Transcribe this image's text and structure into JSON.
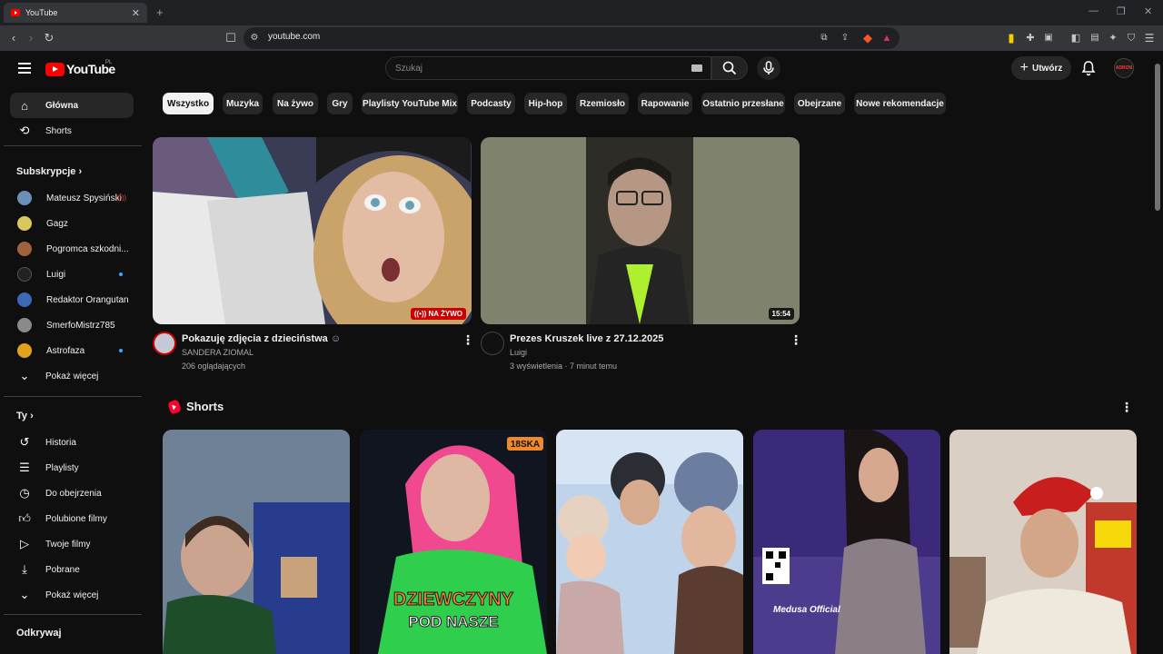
{
  "browser": {
    "tab_title": "YouTube",
    "url": "youtube.com"
  },
  "masthead": {
    "logo_text": "YouTube",
    "country_code": "PL",
    "search_placeholder": "Szukaj",
    "create_label": "Utwórz",
    "avatar_text": "ADRON"
  },
  "sidebar": {
    "nav": [
      {
        "label": "Główna",
        "icon": "home-icon",
        "active": true
      },
      {
        "label": "Shorts",
        "icon": "shorts-icon",
        "active": false
      }
    ],
    "subscriptions_header": "Subskrypcje",
    "subscriptions": [
      {
        "label": "Mateusz Spysiński",
        "indicator": "live"
      },
      {
        "label": "Gagz",
        "indicator": ""
      },
      {
        "label": "Pogromca szkodni...",
        "indicator": ""
      },
      {
        "label": "Luigi",
        "indicator": "new"
      },
      {
        "label": "Redaktor Orangutan",
        "indicator": ""
      },
      {
        "label": "SmerfoMistrz785",
        "indicator": ""
      },
      {
        "label": "Astrofaza",
        "indicator": "new"
      }
    ],
    "show_more": "Pokaż więcej",
    "you_header": "Ty",
    "you_items": [
      {
        "label": "Historia",
        "icon": "history-icon"
      },
      {
        "label": "Playlisty",
        "icon": "playlists-icon"
      },
      {
        "label": "Do obejrzenia",
        "icon": "watch-later-icon"
      },
      {
        "label": "Polubione filmy",
        "icon": "like-icon"
      },
      {
        "label": "Twoje filmy",
        "icon": "your-videos-icon"
      },
      {
        "label": "Pobrane",
        "icon": "download-icon"
      },
      {
        "label": "Pokaż więcej",
        "icon": "chevron-down-icon"
      }
    ],
    "explore_header": "Odkrywaj"
  },
  "chips": [
    "Wszystko",
    "Muzyka",
    "Na żywo",
    "Gry",
    "Playlisty YouTube Mix",
    "Podcasty",
    "Hip-hop",
    "Rzemiosło",
    "Rapowanie",
    "Ostatnio przesłane",
    "Obejrzane",
    "Nowe rekomendacje"
  ],
  "videos": [
    {
      "title": "Pokazuję zdjęcia z dzieciństwa",
      "channel": "SANDERA ZIOMAL",
      "meta": "206 oglądających",
      "badge": "NA ŻYWO"
    },
    {
      "title": "Prezes Kruszek live z 27.12.2025",
      "channel": "Luigi",
      "meta": "3 wyświetlenia · 7 minut temu",
      "badge": "15:54"
    }
  ],
  "shorts": {
    "title": "Shorts",
    "overlays": [
      "",
      "DZIEWCZYNY",
      "POD NASZE",
      "Medusa Official",
      "18SKA"
    ]
  },
  "colors": {
    "accent": "#ff0000",
    "background": "#0f0f0f",
    "chip": "#272727",
    "live": "#cc0000"
  }
}
